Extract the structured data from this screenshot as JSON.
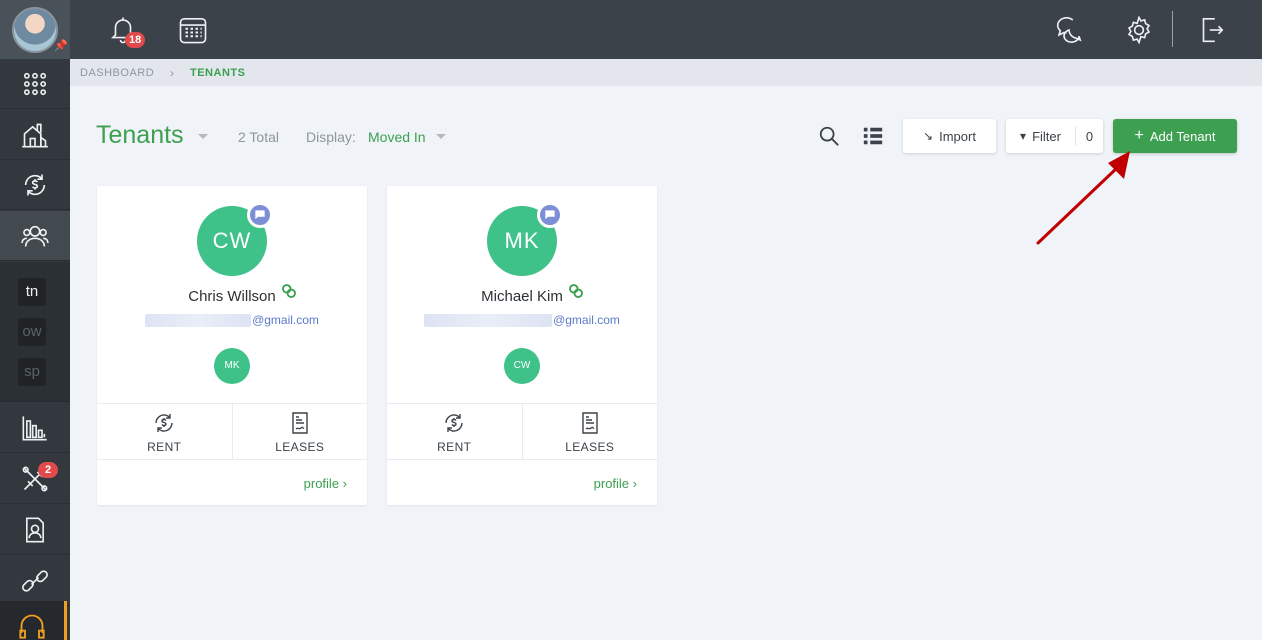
{
  "topbar": {
    "notifications_count": "18"
  },
  "sidebar": {
    "workspaces": [
      "tn",
      "ow",
      "sp"
    ],
    "maintenance_badge": "2"
  },
  "breadcrumb": {
    "root": "DASHBOARD",
    "separator": "›",
    "current": "TENANTS"
  },
  "header": {
    "title": "Tenants",
    "total": "2 Total",
    "display_label": "Display:",
    "display_value": "Moved In"
  },
  "toolbar": {
    "import_label": "Import",
    "filter_label": "Filter",
    "filter_count": "0",
    "add_label": "Add Tenant"
  },
  "colors": {
    "accent_green": "#3ca050",
    "avatar_green": "#3fc18a",
    "annotation_arrow": "#c00000"
  },
  "tenants": [
    {
      "initials": "CW",
      "name": "Chris Willson",
      "email_domain": "@gmail.com",
      "co_tenant_initials": "MK",
      "rent_label": "RENT",
      "leases_label": "LEASES",
      "profile_label": "profile ›"
    },
    {
      "initials": "MK",
      "name": "Michael Kim",
      "email_domain": "@gmail.com",
      "co_tenant_initials": "CW",
      "rent_label": "RENT",
      "leases_label": "LEASES",
      "profile_label": "profile ›"
    }
  ]
}
